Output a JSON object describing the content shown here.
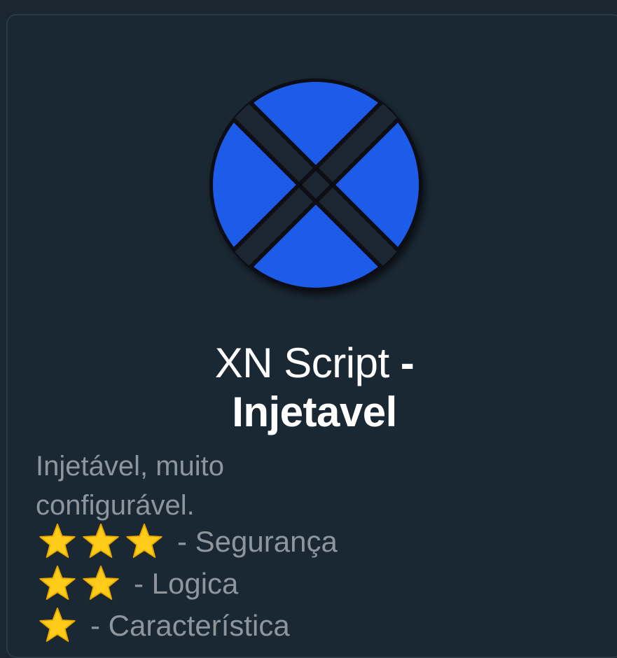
{
  "card": {
    "title_regular": "XN Script",
    "title_dash": " -",
    "title_bold": "Injetavel",
    "description": "Injetável, muito configurável.",
    "ratings": [
      {
        "stars": 3,
        "label": "- Segurança"
      },
      {
        "stars": 2,
        "label": "- Logica"
      },
      {
        "stars": 1,
        "label": "- Característica"
      }
    ]
  },
  "icons": {
    "logo": "x-circle-logo",
    "rating": "star-icon"
  },
  "colors": {
    "background": "#1a2833",
    "logo_blue": "#1a5be8",
    "title": "#ffffff",
    "description": "#8d969d",
    "star": "#ffcc1a"
  }
}
